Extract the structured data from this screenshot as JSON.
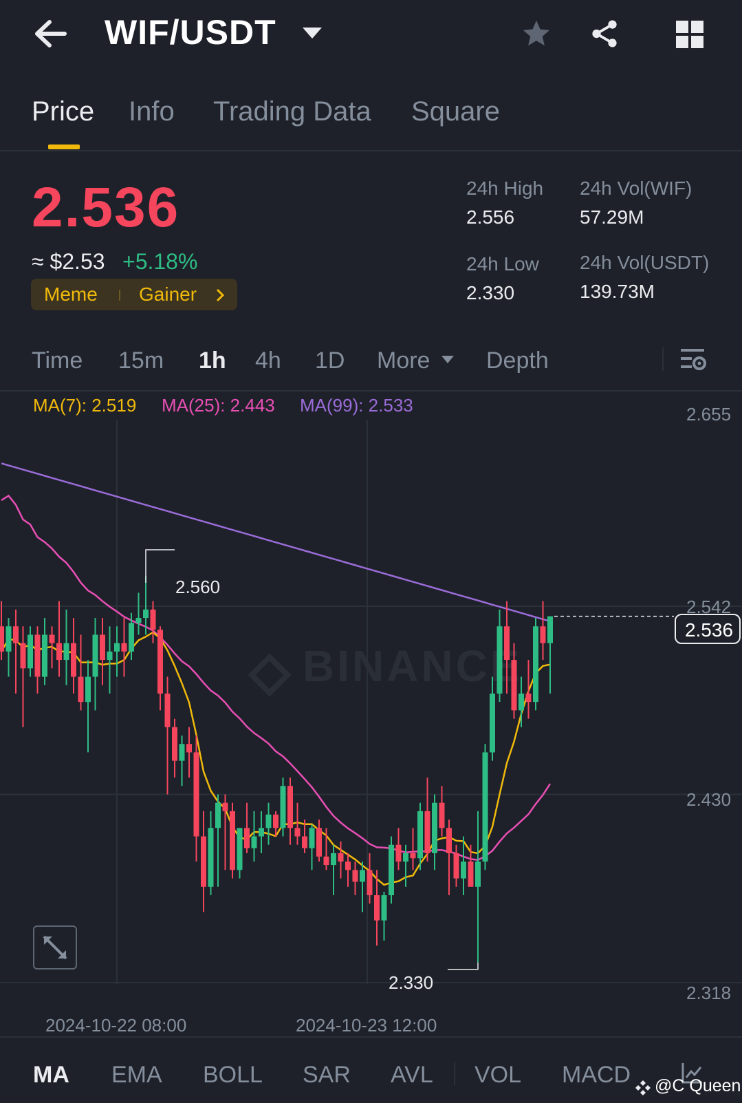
{
  "header": {
    "pair": "WIF/USDT",
    "icons": [
      "back-arrow-icon",
      "caret-down-icon",
      "star-icon",
      "share-icon",
      "grid-icon"
    ]
  },
  "tabs": [
    {
      "label": "Price",
      "active": true
    },
    {
      "label": "Info",
      "active": false
    },
    {
      "label": "Trading Data",
      "active": false
    },
    {
      "label": "Square",
      "active": false
    }
  ],
  "ticker": {
    "last_price": "2.536",
    "approx_usd": "≈ $2.53",
    "change_pct": "+5.18%",
    "tags": [
      "Meme",
      "Gainer"
    ],
    "stats": {
      "high_label": "24h High",
      "high": "2.556",
      "low_label": "24h Low",
      "low": "2.330",
      "vol_base_label": "24h Vol(WIF)",
      "vol_base": "57.29M",
      "vol_quote_label": "24h Vol(USDT)",
      "vol_quote": "139.73M"
    }
  },
  "intervals": [
    {
      "label": "Time",
      "active": false
    },
    {
      "label": "15m",
      "active": false
    },
    {
      "label": "1h",
      "active": true
    },
    {
      "label": "4h",
      "active": false
    },
    {
      "label": "1D",
      "active": false
    },
    {
      "label": "More",
      "active": false
    },
    {
      "label": "Depth",
      "active": false
    }
  ],
  "ma_legend": {
    "ma7": "MA(7): 2.519",
    "ma25": "MA(25): 2.443",
    "ma99": "MA(99): 2.533"
  },
  "colors": {
    "up": "#2ebd85",
    "down": "#f6465d",
    "accent": "#f0b90b",
    "ma7": "#f0b90b",
    "ma25": "#e84fb5",
    "ma99": "#9b6cd9"
  },
  "chart_data": {
    "type": "candlestick",
    "interval": "1h",
    "y_ticks": [
      "2.655",
      "2.542",
      "2.430",
      "2.318"
    ],
    "ylim": [
      2.318,
      2.655
    ],
    "x_ticks": [
      "2024-10-22 08:00",
      "2024-10-23 12:00"
    ],
    "high_marker": "2.560",
    "low_marker": "2.330",
    "last_price_marker": "2.536",
    "candles": [
      {
        "o": 2.53,
        "h": 2.545,
        "l": 2.51,
        "c": 2.515
      },
      {
        "o": 2.515,
        "h": 2.535,
        "l": 2.5,
        "c": 2.53
      },
      {
        "o": 2.53,
        "h": 2.54,
        "l": 2.49,
        "c": 2.52
      },
      {
        "o": 2.52,
        "h": 2.53,
        "l": 2.47,
        "c": 2.505
      },
      {
        "o": 2.505,
        "h": 2.53,
        "l": 2.5,
        "c": 2.525
      },
      {
        "o": 2.525,
        "h": 2.53,
        "l": 2.49,
        "c": 2.5
      },
      {
        "o": 2.5,
        "h": 2.535,
        "l": 2.495,
        "c": 2.525
      },
      {
        "o": 2.525,
        "h": 2.53,
        "l": 2.505,
        "c": 2.52
      },
      {
        "o": 2.52,
        "h": 2.545,
        "l": 2.5,
        "c": 2.51
      },
      {
        "o": 2.51,
        "h": 2.54,
        "l": 2.495,
        "c": 2.52
      },
      {
        "o": 2.52,
        "h": 2.535,
        "l": 2.49,
        "c": 2.5
      },
      {
        "o": 2.5,
        "h": 2.525,
        "l": 2.48,
        "c": 2.485
      },
      {
        "o": 2.485,
        "h": 2.51,
        "l": 2.455,
        "c": 2.5
      },
      {
        "o": 2.5,
        "h": 2.535,
        "l": 2.48,
        "c": 2.525
      },
      {
        "o": 2.525,
        "h": 2.535,
        "l": 2.495,
        "c": 2.51
      },
      {
        "o": 2.51,
        "h": 2.53,
        "l": 2.49,
        "c": 2.515
      },
      {
        "o": 2.515,
        "h": 2.53,
        "l": 2.5,
        "c": 2.52
      },
      {
        "o": 2.52,
        "h": 2.535,
        "l": 2.5,
        "c": 2.515
      },
      {
        "o": 2.515,
        "h": 2.538,
        "l": 2.51,
        "c": 2.532
      },
      {
        "o": 2.532,
        "h": 2.55,
        "l": 2.525,
        "c": 2.535
      },
      {
        "o": 2.535,
        "h": 2.56,
        "l": 2.525,
        "c": 2.54
      },
      {
        "o": 2.54,
        "h": 2.545,
        "l": 2.52,
        "c": 2.528
      },
      {
        "o": 2.528,
        "h": 2.53,
        "l": 2.48,
        "c": 2.49
      },
      {
        "o": 2.49,
        "h": 2.5,
        "l": 2.43,
        "c": 2.47
      },
      {
        "o": 2.47,
        "h": 2.475,
        "l": 2.44,
        "c": 2.45
      },
      {
        "o": 2.45,
        "h": 2.465,
        "l": 2.435,
        "c": 2.46
      },
      {
        "o": 2.46,
        "h": 2.47,
        "l": 2.44,
        "c": 2.455
      },
      {
        "o": 2.455,
        "h": 2.465,
        "l": 2.39,
        "c": 2.405
      },
      {
        "o": 2.405,
        "h": 2.42,
        "l": 2.36,
        "c": 2.375
      },
      {
        "o": 2.375,
        "h": 2.42,
        "l": 2.37,
        "c": 2.41
      },
      {
        "o": 2.41,
        "h": 2.43,
        "l": 2.375,
        "c": 2.425
      },
      {
        "o": 2.425,
        "h": 2.43,
        "l": 2.385,
        "c": 2.42
      },
      {
        "o": 2.42,
        "h": 2.425,
        "l": 2.38,
        "c": 2.385
      },
      {
        "o": 2.385,
        "h": 2.4,
        "l": 2.38,
        "c": 2.41
      },
      {
        "o": 2.41,
        "h": 2.425,
        "l": 2.395,
        "c": 2.398
      },
      {
        "o": 2.398,
        "h": 2.42,
        "l": 2.39,
        "c": 2.405
      },
      {
        "o": 2.405,
        "h": 2.42,
        "l": 2.395,
        "c": 2.41
      },
      {
        "o": 2.41,
        "h": 2.425,
        "l": 2.4,
        "c": 2.418
      },
      {
        "o": 2.418,
        "h": 2.42,
        "l": 2.405,
        "c": 2.41
      },
      {
        "o": 2.41,
        "h": 2.44,
        "l": 2.405,
        "c": 2.435
      },
      {
        "o": 2.435,
        "h": 2.44,
        "l": 2.4,
        "c": 2.41
      },
      {
        "o": 2.41,
        "h": 2.425,
        "l": 2.4,
        "c": 2.405
      },
      {
        "o": 2.405,
        "h": 2.415,
        "l": 2.395,
        "c": 2.398
      },
      {
        "o": 2.398,
        "h": 2.412,
        "l": 2.385,
        "c": 2.41
      },
      {
        "o": 2.41,
        "h": 2.415,
        "l": 2.39,
        "c": 2.393
      },
      {
        "o": 2.393,
        "h": 2.41,
        "l": 2.385,
        "c": 2.388
      },
      {
        "o": 2.388,
        "h": 2.4,
        "l": 2.37,
        "c": 2.395
      },
      {
        "o": 2.395,
        "h": 2.402,
        "l": 2.38,
        "c": 2.39
      },
      {
        "o": 2.39,
        "h": 2.395,
        "l": 2.375,
        "c": 2.385
      },
      {
        "o": 2.385,
        "h": 2.39,
        "l": 2.37,
        "c": 2.378
      },
      {
        "o": 2.378,
        "h": 2.39,
        "l": 2.36,
        "c": 2.385
      },
      {
        "o": 2.385,
        "h": 2.395,
        "l": 2.365,
        "c": 2.37
      },
      {
        "o": 2.37,
        "h": 2.385,
        "l": 2.34,
        "c": 2.355
      },
      {
        "o": 2.355,
        "h": 2.372,
        "l": 2.343,
        "c": 2.37
      },
      {
        "o": 2.37,
        "h": 2.405,
        "l": 2.365,
        "c": 2.4
      },
      {
        "o": 2.4,
        "h": 2.41,
        "l": 2.385,
        "c": 2.39
      },
      {
        "o": 2.39,
        "h": 2.4,
        "l": 2.375,
        "c": 2.395
      },
      {
        "o": 2.395,
        "h": 2.41,
        "l": 2.385,
        "c": 2.392
      },
      {
        "o": 2.392,
        "h": 2.425,
        "l": 2.385,
        "c": 2.42
      },
      {
        "o": 2.42,
        "h": 2.44,
        "l": 2.39,
        "c": 2.395
      },
      {
        "o": 2.395,
        "h": 2.43,
        "l": 2.385,
        "c": 2.425
      },
      {
        "o": 2.425,
        "h": 2.435,
        "l": 2.405,
        "c": 2.41
      },
      {
        "o": 2.41,
        "h": 2.415,
        "l": 2.37,
        "c": 2.395
      },
      {
        "o": 2.395,
        "h": 2.4,
        "l": 2.375,
        "c": 2.38
      },
      {
        "o": 2.38,
        "h": 2.405,
        "l": 2.37,
        "c": 2.39
      },
      {
        "o": 2.39,
        "h": 2.4,
        "l": 2.38,
        "c": 2.375
      },
      {
        "o": 2.375,
        "h": 2.42,
        "l": 2.33,
        "c": 2.39
      },
      {
        "o": 2.39,
        "h": 2.46,
        "l": 2.385,
        "c": 2.455
      },
      {
        "o": 2.455,
        "h": 2.5,
        "l": 2.45,
        "c": 2.49
      },
      {
        "o": 2.49,
        "h": 2.54,
        "l": 2.485,
        "c": 2.53
      },
      {
        "o": 2.53,
        "h": 2.545,
        "l": 2.49,
        "c": 2.51
      },
      {
        "o": 2.51,
        "h": 2.52,
        "l": 2.475,
        "c": 2.48
      },
      {
        "o": 2.48,
        "h": 2.5,
        "l": 2.47,
        "c": 2.49
      },
      {
        "o": 2.49,
        "h": 2.51,
        "l": 2.475,
        "c": 2.485
      },
      {
        "o": 2.485,
        "h": 2.535,
        "l": 2.48,
        "c": 2.53
      },
      {
        "o": 2.53,
        "h": 2.545,
        "l": 2.51,
        "c": 2.52
      },
      {
        "o": 2.52,
        "h": 2.535,
        "l": 2.49,
        "c": 2.536
      }
    ]
  },
  "indicators": [
    {
      "label": "MA",
      "active": true
    },
    {
      "label": "EMA",
      "active": false
    },
    {
      "label": "BOLL",
      "active": false
    },
    {
      "label": "SAR",
      "active": false
    },
    {
      "label": "AVL",
      "active": false
    },
    {
      "label": "VOL",
      "active": false
    },
    {
      "label": "MACD",
      "active": false
    }
  ],
  "watermark": "@C Queen"
}
